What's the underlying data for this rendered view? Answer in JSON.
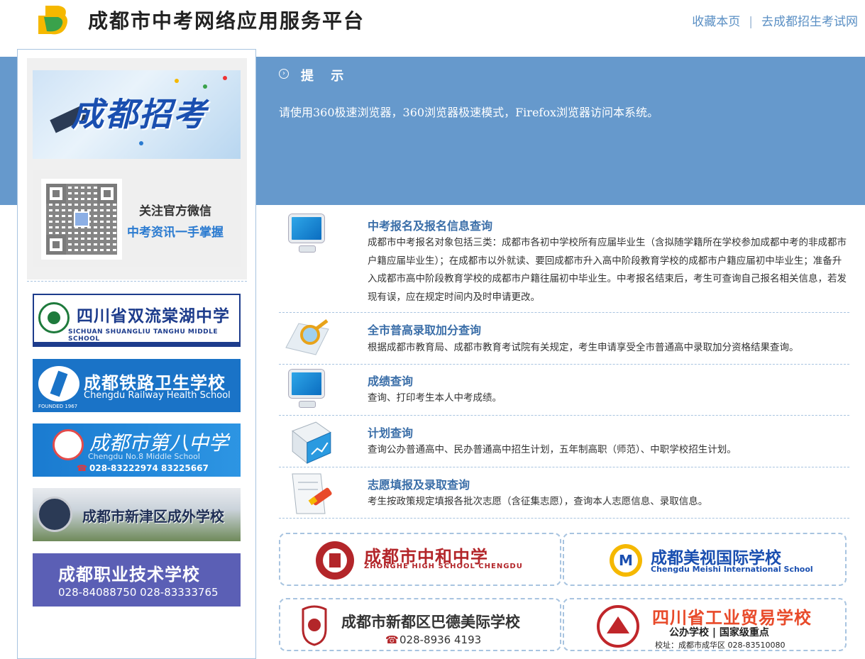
{
  "header": {
    "title": "成都市中考网络应用服务平台",
    "links": [
      "收藏本页",
      "去成都招生考试网"
    ],
    "separator": "|"
  },
  "sidebar": {
    "banner_text": "成都招考",
    "qr_caption_1": "关注官方微信",
    "qr_caption_2": "中考资讯一手掌握",
    "ads": [
      {
        "name": "四川省双流棠湖中学",
        "sub": "SICHUAN SHUANGLIU  TANGHU MIDDLE SCHOOL"
      },
      {
        "name": "成都铁路卫生学校",
        "sub": "Chengdu Railway Health School",
        "foot": "FOUNDED 1967"
      },
      {
        "name": "成都市第八中学",
        "sub": "Chengdu No.8 Middle School",
        "phone": "028-83222974  83225667"
      },
      {
        "name": "成都市新津区成外学校"
      },
      {
        "name": "成都职业技术学校",
        "phone": "028-84088750    028-83333765"
      }
    ]
  },
  "notice": {
    "title": "提 示",
    "text": "请使用360极速浏览器，360浏览器极速模式，Firefox浏览器访问本系统。"
  },
  "services": [
    {
      "title": "中考报名及报名信息查询",
      "desc": "成都市中考报名对象包括三类：成都市各初中学校所有应届毕业生（含拟随学籍所在学校参加成都中考的非成都市户籍应届毕业生）；在成都市以外就读、要回成都市升入高中阶段教育学校的成都市户籍应届初中毕业生；准备升入成都市高中阶段教育学校的成都市户籍往届初中毕业生。中考报名结束后，考生可查询自己报名相关信息，若发现有误，应在规定时间内及时申请更改。",
      "icon": "monitor-icon"
    },
    {
      "title": "全市普高录取加分查询",
      "desc": "根据成都市教育局、成都市教育考试院有关规定，考生申请享受全市普通高中录取加分资格结果查询。",
      "icon": "magnifier-icon"
    },
    {
      "title": "成绩查询",
      "desc": "查询、打印考生本人中考成绩。",
      "icon": "monitor-icon"
    },
    {
      "title": "计划查询",
      "desc": "查询公办普通高中、民办普通高中招生计划，五年制高职（师范）、中职学校招生计划。",
      "icon": "chart-box-icon"
    },
    {
      "title": "志愿填报及录取查询",
      "desc": "考生按政策规定填报各批次志愿（含征集志愿），查询本人志愿信息、录取信息。",
      "icon": "pen-paper-icon"
    }
  ],
  "schools": [
    {
      "name": "成都市中和中学",
      "sub": "ZHONGHE HIGH SCHOOL CHENGDU"
    },
    {
      "name": "成都美视国际学校",
      "sub": "Chengdu Meishi International School"
    },
    {
      "name": "成都市新都区巴德美际学校",
      "phone": "028-8936 4193"
    },
    {
      "name": "四川省工业贸易学校",
      "sub": "公办学校 | 国家级重点",
      "addr": "校址：成都市成华区  028-83510080"
    }
  ],
  "colors": {
    "band": "#6699cc",
    "link": "#5a8fc4",
    "service_title": "#3a6ea8"
  }
}
